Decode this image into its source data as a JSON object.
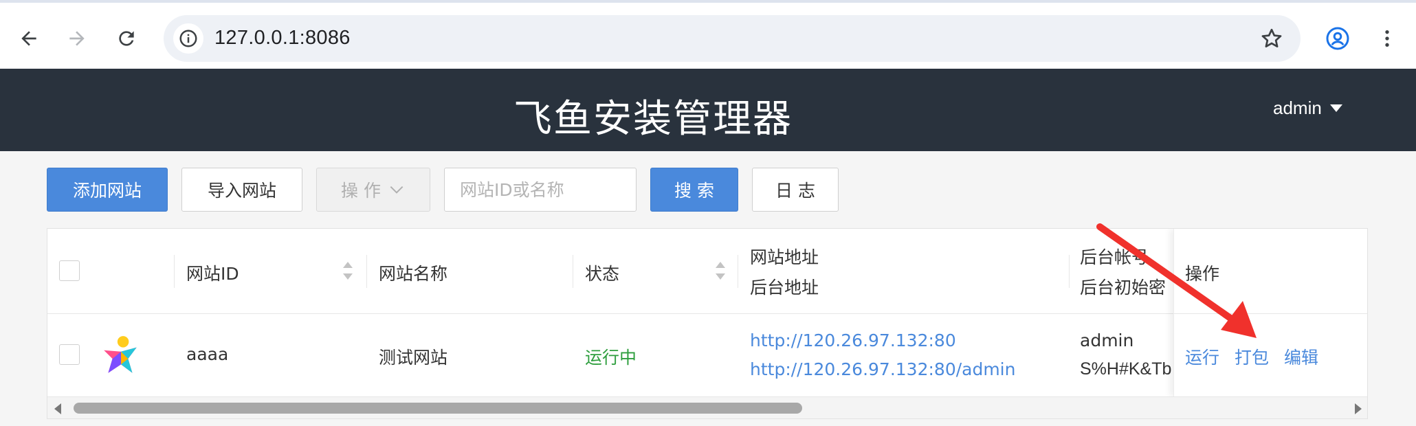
{
  "browser": {
    "url": "127.0.0.1:8086",
    "icons": {
      "back": "arrow-left-icon",
      "forward": "arrow-right-icon",
      "reload": "reload-icon",
      "info": "info-icon",
      "bookmark": "star-icon",
      "profile": "account-circle-icon",
      "menu": "more-vert-icon"
    }
  },
  "header": {
    "title": "飞鱼安装管理器",
    "user": "admin"
  },
  "toolbar": {
    "add_site": "添加网站",
    "import_site": "导入网站",
    "actions": "操 作",
    "search_placeholder": "网站ID或名称",
    "search": "搜 索",
    "log": "日 志"
  },
  "table": {
    "columns": {
      "site_id": "网站ID",
      "site_name": "网站名称",
      "status": "状态",
      "site_url": "网站地址",
      "admin_url": "后台地址",
      "admin_account": "后台帐号",
      "admin_password": "后台初始密",
      "operations": "操作"
    },
    "rows": [
      {
        "site_id": "aaaa",
        "site_name": "测试网站",
        "status": "运行中",
        "site_url": "http://120.26.97.132:80",
        "admin_url": "http://120.26.97.132:80/admin",
        "admin_account": "admin",
        "admin_password": "S%H#K&Tb",
        "actions": {
          "run": "运行",
          "pack": "打包",
          "edit": "编辑"
        }
      }
    ]
  },
  "colors": {
    "header_bg": "#29323d",
    "primary": "#4a89dc",
    "status_running": "#2e9e3e",
    "annotation_arrow": "#f0312c"
  }
}
